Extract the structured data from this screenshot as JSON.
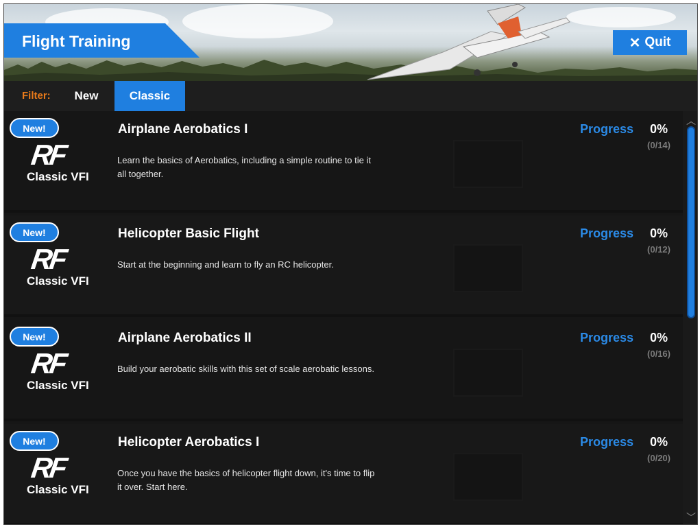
{
  "header": {
    "title": "Flight Training",
    "quit_label": "Quit"
  },
  "filter": {
    "label": "Filter:",
    "tabs": [
      {
        "label": "New",
        "active": false
      },
      {
        "label": "Classic",
        "active": true
      }
    ]
  },
  "courses": [
    {
      "badge": "New!",
      "logo": "RF",
      "logo_sub": "Classic VFI",
      "title": "Airplane Aerobatics I",
      "description": "Learn the basics of Aerobatics, including a simple routine to tie it all together.",
      "progress_label": "Progress",
      "progress_percent": "0%",
      "progress_count": "(0/14)"
    },
    {
      "badge": "New!",
      "logo": "RF",
      "logo_sub": "Classic VFI",
      "title": "Helicopter Basic Flight",
      "description": "Start at the beginning and learn to fly an RC helicopter.",
      "progress_label": "Progress",
      "progress_percent": "0%",
      "progress_count": "(0/12)"
    },
    {
      "badge": "New!",
      "logo": "RF",
      "logo_sub": "Classic VFI",
      "title": "Airplane Aerobatics II",
      "description": "Build your aerobatic skills with this set of scale aerobatic lessons.",
      "progress_label": "Progress",
      "progress_percent": "0%",
      "progress_count": "(0/16)"
    },
    {
      "badge": "New!",
      "logo": "RF",
      "logo_sub": "Classic VFI",
      "title": "Helicopter Aerobatics I",
      "description": "Once you have the basics of helicopter flight down, it's time to flip it over. Start here.",
      "progress_label": "Progress",
      "progress_percent": "0%",
      "progress_count": "(0/20)"
    }
  ],
  "colors": {
    "accent": "#1f7fe0",
    "filter_label": "#e87a1a",
    "progress_label": "#2b8ae6",
    "background": "#161616"
  },
  "icons": {
    "quit": "close-icon",
    "scroll_up": "chevron-up-icon",
    "scroll_down": "chevron-down-icon"
  }
}
